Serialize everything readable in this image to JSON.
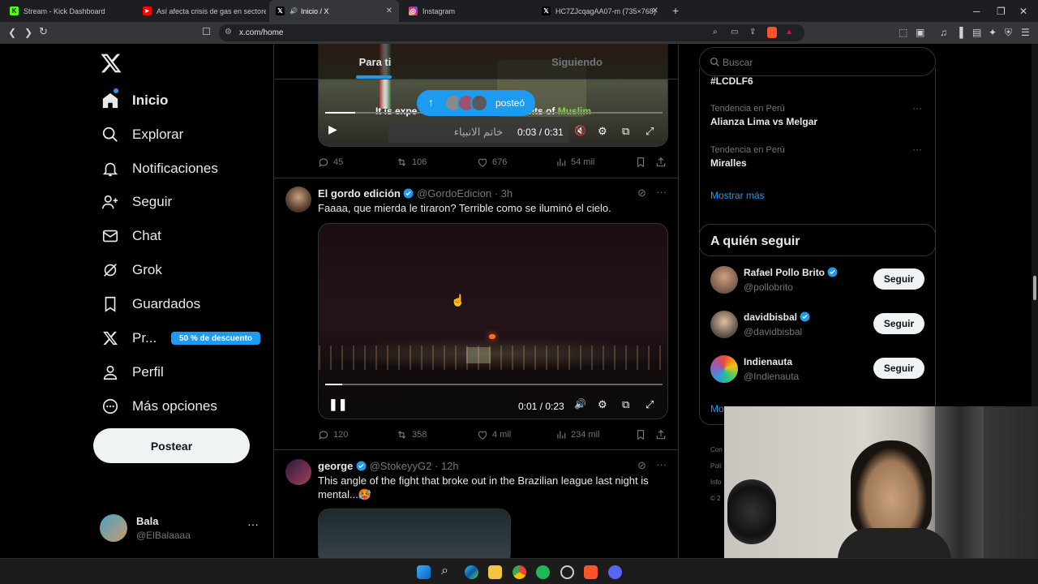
{
  "browser": {
    "tabs": [
      {
        "title": "Stream - Kick Dashboard",
        "color": "#53fc18",
        "glyph": "K"
      },
      {
        "title": "Así afecta crisis de gas en sectores de",
        "color": "#ff0000",
        "glyph": "▶"
      },
      {
        "title": "Inicio / X",
        "color": "#000000",
        "glyph": "X"
      },
      {
        "title": "Instagram",
        "color": "#e1306c",
        "glyph": "◎"
      },
      {
        "title": "HC7ZJcqagAA07-m (735×768)",
        "color": "#000000",
        "glyph": "X"
      }
    ],
    "url": "x.com/home",
    "new_tab": "+"
  },
  "nav": {
    "logo": "X",
    "items": [
      {
        "label": "Inicio",
        "icon": "home-icon"
      },
      {
        "label": "Explorar",
        "icon": "search-icon"
      },
      {
        "label": "Notificaciones",
        "icon": "bell-icon"
      },
      {
        "label": "Seguir",
        "icon": "person-add-icon"
      },
      {
        "label": "Chat",
        "icon": "mail-icon"
      },
      {
        "label": "Grok",
        "icon": "grok-icon"
      },
      {
        "label": "Guardados",
        "icon": "bookmark-icon"
      },
      {
        "label": "Pr...",
        "icon": "x-premium-icon",
        "badge": "50 % de descuento"
      },
      {
        "label": "Perfil",
        "icon": "person-icon"
      },
      {
        "label": "Más opciones",
        "icon": "more-circle-icon"
      }
    ],
    "post_button": "Postear",
    "account": {
      "name": "Bala",
      "handle": "@ElBalaaaa"
    }
  },
  "feed": {
    "tabs": [
      "Para ti",
      "Siguiendo"
    ],
    "posted_pill": "posteó",
    "tweet1": {
      "caption_pre": "It is expe",
      "caption_mid": "ments of ",
      "caption_hl": "Muslim",
      "time": "0:03 / 0:31",
      "replies": "45",
      "reposts": "106",
      "likes": "676",
      "views": "54 mil"
    },
    "tweet2": {
      "name": "El gordo edición",
      "handle": "@GordoEdicion",
      "time": "· 3h",
      "text": "Faaaa, que mierda le tiraron? Terrible como se iluminó el cielo.",
      "video_time": "0:01 / 0:23",
      "replies": "120",
      "reposts": "358",
      "likes": "4 mil",
      "views": "234 mil"
    },
    "tweet3": {
      "name": "george",
      "handle": "@StokeyyG2",
      "time": "· 12h",
      "text": "This angle of the fight that broke out in the Brazilian league last night is mental...🥵"
    }
  },
  "sidebar": {
    "search_placeholder": "Buscar",
    "trends_partial": "#LCDLF6",
    "trends": [
      {
        "context": "Tendencia en Perú",
        "title": "Alianza Lima vs Melgar"
      },
      {
        "context": "Tendencia en Perú",
        "title": "Miralles"
      }
    ],
    "show_more": "Mostrar más",
    "who_to_follow": {
      "title": "A quién seguir",
      "users": [
        {
          "name": "Rafael Pollo Brito",
          "handle": "@pollobrito",
          "button": "Seguir"
        },
        {
          "name": "davidbisbal",
          "handle": "@davidbisbal",
          "button": "Seguir"
        },
        {
          "name": "Indienauta",
          "handle": "@Indienauta",
          "button": "Seguir"
        }
      ],
      "show_more_partial": "Mostrar más"
    },
    "footer_partial": [
      "Con",
      "Polí",
      "Info",
      "© 2"
    ]
  }
}
